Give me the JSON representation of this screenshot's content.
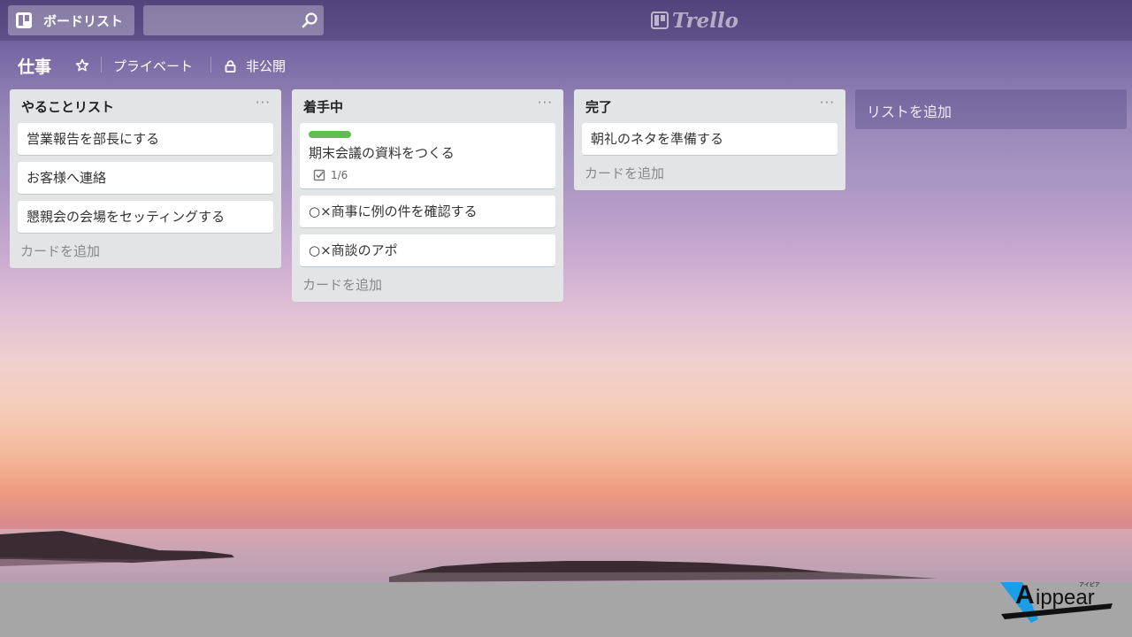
{
  "header": {
    "boards_label": "ボードリスト",
    "search_value": "",
    "logo_text": "Trello"
  },
  "board": {
    "title": "仕事",
    "privacy_label": "プライベート",
    "visibility_label": "非公開"
  },
  "lists": [
    {
      "title": "やることリスト",
      "menu": "···",
      "cards": [
        {
          "title": "営業報告を部長にする"
        },
        {
          "title": "お客様へ連絡"
        },
        {
          "title": "懇親会の会場をセッティングする"
        }
      ],
      "add_card": "カードを追加"
    },
    {
      "title": "着手中",
      "menu": "···",
      "cards": [
        {
          "title": "期末会議の資料をつくる",
          "label_color": "#61bd4f",
          "checklist": "1/6"
        },
        {
          "title": "○×商事に例の件を確認する"
        },
        {
          "title": "○×商談のアポ"
        }
      ],
      "add_card": "カードを追加"
    },
    {
      "title": "完了",
      "menu": "···",
      "cards": [
        {
          "title": "朝礼のネタを準備する"
        }
      ],
      "add_card": "カードを追加"
    }
  ],
  "add_list_label": "リストを追加",
  "watermark": {
    "text": "Aippear",
    "small_text": "アイピア"
  }
}
